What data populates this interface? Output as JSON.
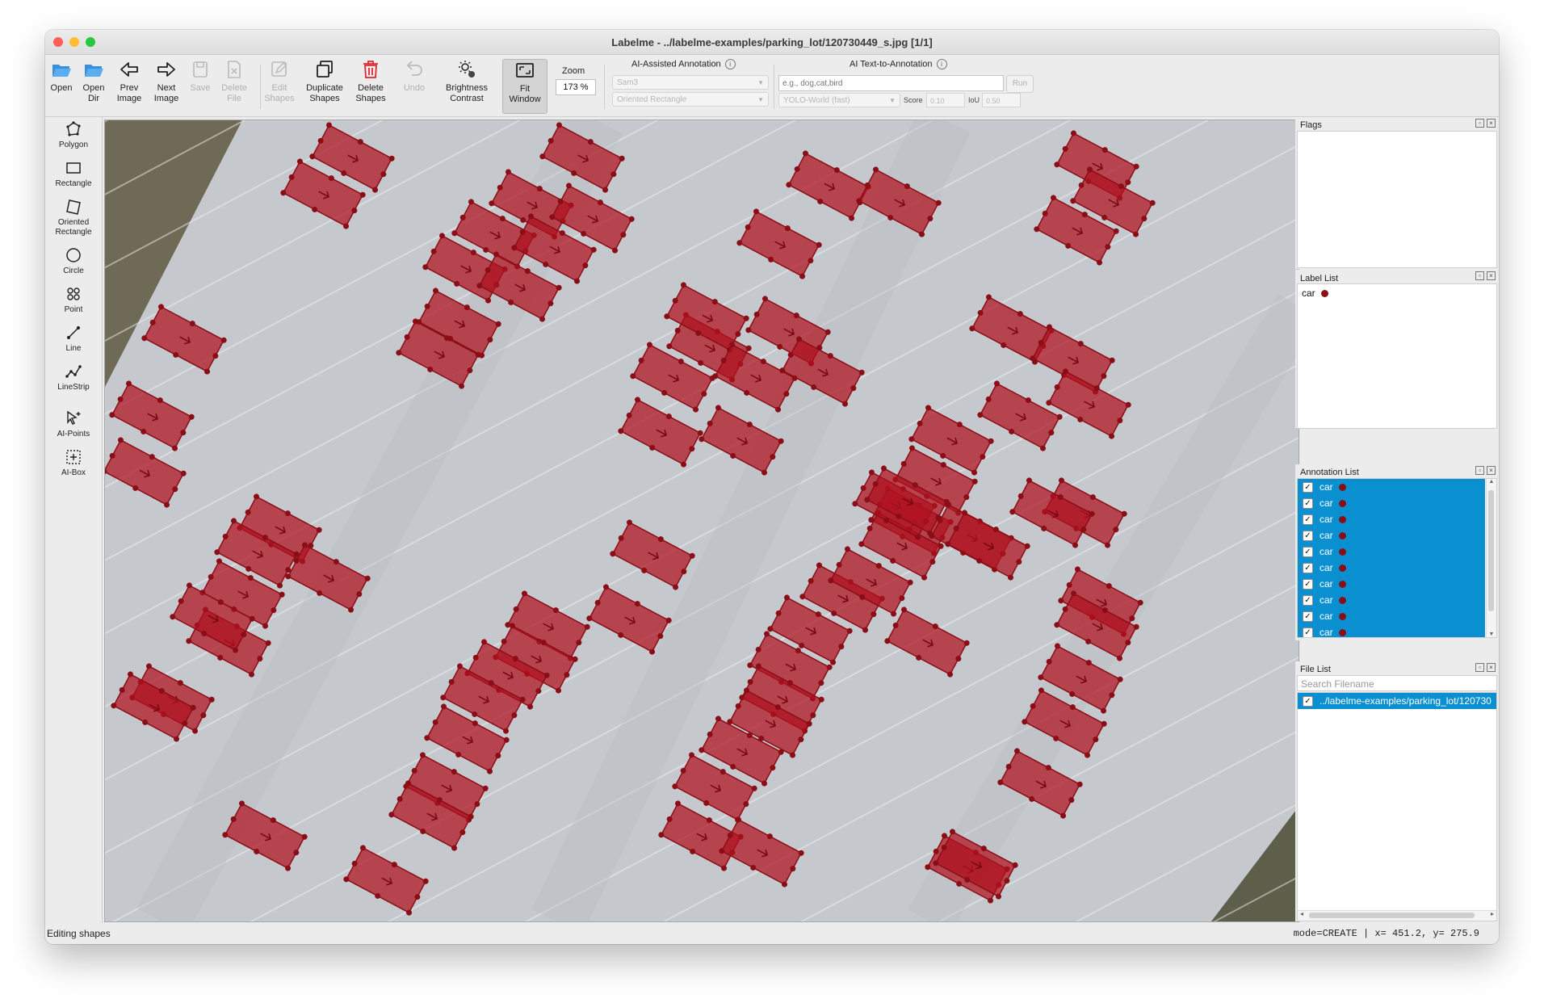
{
  "window": {
    "title": "Labelme - ../labelme-examples/parking_lot/120730449_s.jpg [1/1]",
    "traffic_colors": [
      "#fe5f57",
      "#febc2e",
      "#28c840"
    ]
  },
  "toolbar": {
    "open": "Open",
    "open_dir": "Open\nDir",
    "prev_image": "Prev\nImage",
    "next_image": "Next\nImage",
    "save": "Save",
    "delete_file": "Delete\nFile",
    "edit_shapes": "Edit\nShapes",
    "duplicate_shapes": "Duplicate\nShapes",
    "delete_shapes": "Delete\nShapes",
    "undo": "Undo",
    "brightness_contrast": "Brightness\nContrast",
    "fit_window": "Fit\nWindow",
    "zoom_label": "Zoom",
    "zoom_value": "173 %"
  },
  "ai_assisted": {
    "label": "AI-Assisted Annotation",
    "model": "Sam3",
    "shape_type": "Oriented Rectangle"
  },
  "ai_text": {
    "label": "AI Text-to-Annotation",
    "prompt_placeholder": "e.g., dog,cat,bird",
    "run_label": "Run",
    "model": "YOLO-World (fast)",
    "score_label": "Score",
    "score_value": "0.10",
    "iou_label": "IoU",
    "iou_value": "0.50"
  },
  "tools": {
    "polygon": "Polygon",
    "rectangle": "Rectangle",
    "oriented_rectangle": "Oriented\nRectangle",
    "circle": "Circle",
    "point": "Point",
    "line": "Line",
    "linestrip": "LineStrip",
    "ai_points": "AI-Points",
    "ai_box": "AI-Box"
  },
  "docks": {
    "flags_title": "Flags",
    "label_list_title": "Label List",
    "labels": [
      {
        "name": "car",
        "color": "#8b0d16"
      }
    ],
    "annotation_list_title": "Annotation List",
    "annotations": [
      {
        "label": "car"
      },
      {
        "label": "car"
      },
      {
        "label": "car"
      },
      {
        "label": "car"
      },
      {
        "label": "car"
      },
      {
        "label": "car"
      },
      {
        "label": "car"
      },
      {
        "label": "car"
      },
      {
        "label": "car"
      },
      {
        "label": "car"
      }
    ],
    "file_list_title": "File List",
    "file_search_placeholder": "Search Filename",
    "files": [
      "../labelme-examples/parking_lot/120730"
    ]
  },
  "status": {
    "left": "Editing shapes",
    "right": "mode=CREATE  |  x=  451.2, y=  275.9"
  },
  "colors": {
    "selection": "#0a8fd0",
    "car_fill": "#b0101e",
    "vertex": "#8b0d16"
  }
}
